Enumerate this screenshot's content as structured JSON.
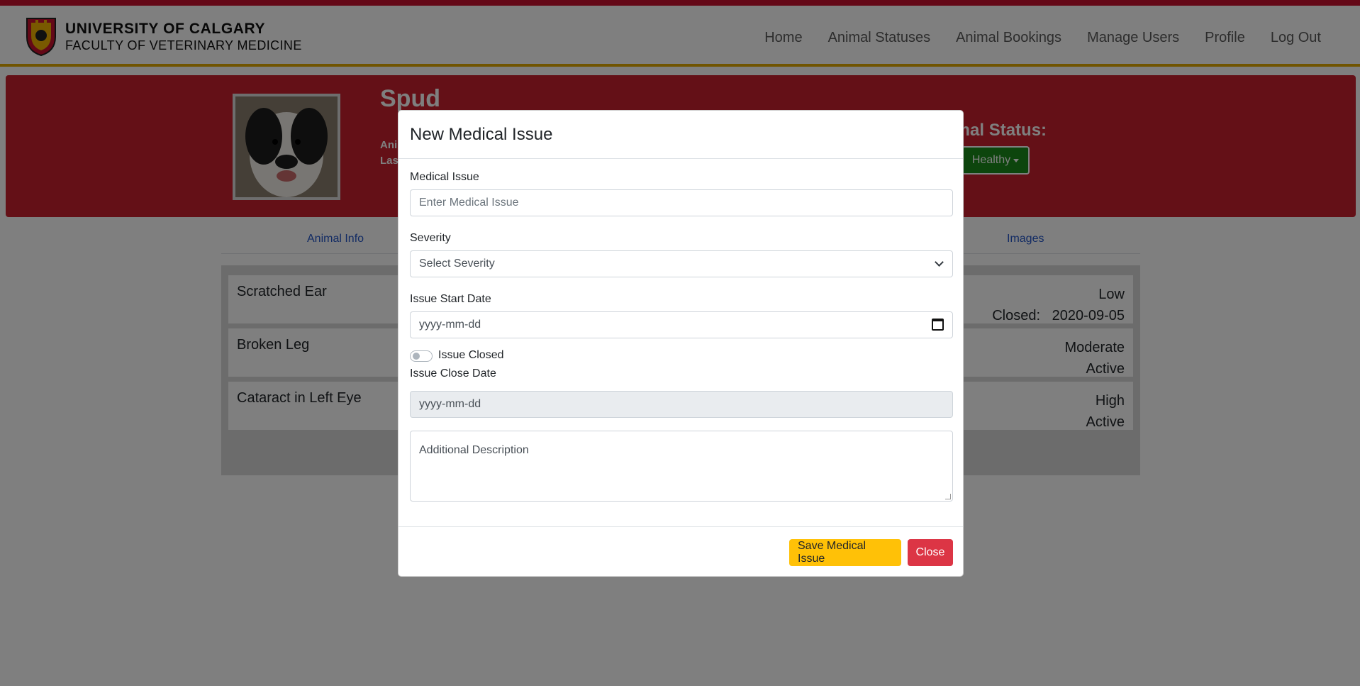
{
  "header": {
    "brand_line1": "UNIVERSITY OF CALGARY",
    "brand_line2": "FACULTY OF VETERINARY MEDICINE",
    "nav": [
      "Home",
      "Animal Statuses",
      "Animal Bookings",
      "Manage Users",
      "Profile",
      "Log Out"
    ]
  },
  "animal": {
    "name": "Spud",
    "info_line1": "Ani",
    "info_line2": "Las",
    "status_label": "imal Status:",
    "status_value": "Healthy"
  },
  "tabs": [
    "Animal Info",
    "Images"
  ],
  "issues": [
    {
      "title": "Scratched Ear",
      "severity": "Low",
      "state": "Closed:   2020-09-05"
    },
    {
      "title": "Broken Leg",
      "severity": "Moderate",
      "state": "Active"
    },
    {
      "title": "Cataract in Left Eye",
      "severity": "High",
      "state": "Active"
    }
  ],
  "modal": {
    "title": "New Medical Issue",
    "medical_issue_label": "Medical Issue",
    "medical_issue_placeholder": "Enter Medical Issue",
    "severity_label": "Severity",
    "severity_selected": "Select Severity",
    "start_date_label": "Issue Start Date",
    "start_date_value": "yyyy-mm-dd",
    "closed_toggle_label": "Issue Closed",
    "close_date_label": "Issue Close Date",
    "close_date_value": "yyyy-mm-dd",
    "description_placeholder": "Additional Description",
    "save_label": "Save Medical Issue",
    "close_label": "Close"
  },
  "colors": {
    "brand_red": "#c8202e",
    "brand_gold": "#e0a800",
    "healthy_green": "#1a8a1a",
    "save_yellow": "#ffc107",
    "close_red": "#dc3545"
  }
}
